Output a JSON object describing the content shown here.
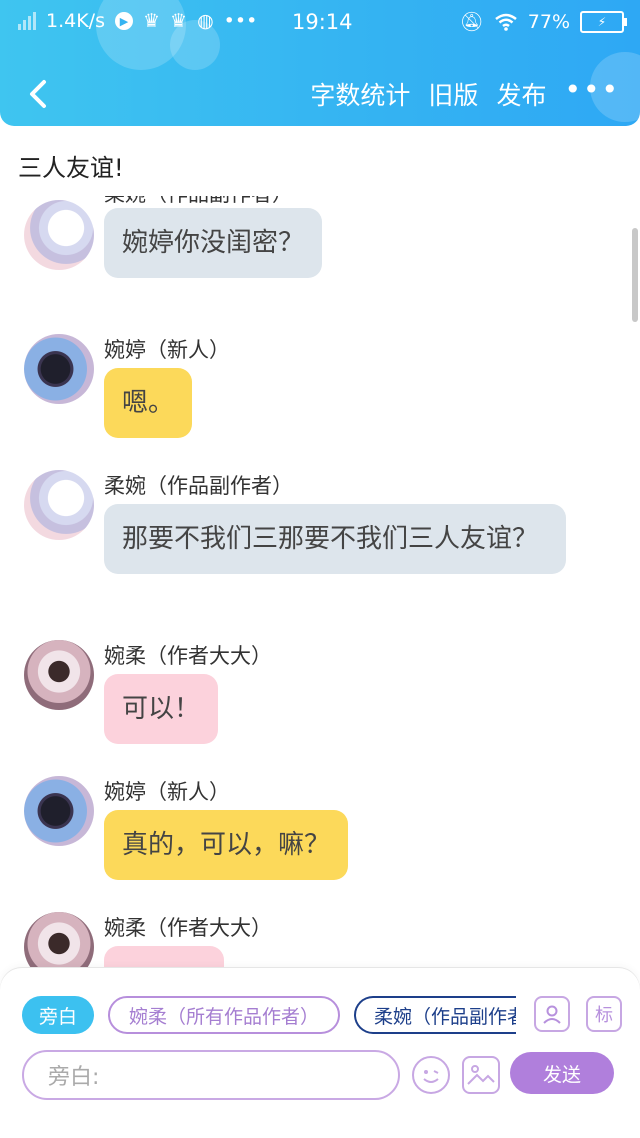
{
  "status_bar": {
    "speed": "1.4K/s",
    "time": "19:14",
    "battery_percent": "77%",
    "icons": [
      "signal-icon",
      "play-icon",
      "crown-icon",
      "crown-icon",
      "wechat-icon",
      "more-dots-icon",
      "mute-icon",
      "wifi-icon",
      "battery-icon"
    ]
  },
  "navbar": {
    "word_count_label": "字数统计",
    "old_version_label": "旧版",
    "publish_label": "发布",
    "more_label": "•••"
  },
  "story_title": "三人友谊!",
  "messages": [
    {
      "sender": "柔婉（作品副作者）",
      "text": "婉婷你没闺密？",
      "style": "gray",
      "avatar": "avatar-rouwan"
    },
    {
      "sender": "婉婷（新人）",
      "text": "嗯。",
      "style": "yellow",
      "avatar": "avatar-wanting"
    },
    {
      "sender": "柔婉（作品副作者）",
      "text": "那要不我们三那要不我们三人友谊？",
      "style": "gray",
      "avatar": "avatar-rouwan"
    },
    {
      "sender": "婉柔（作者大大）",
      "text": "可以！",
      "style": "pink",
      "avatar": "avatar-wanrou"
    },
    {
      "sender": "婉婷（新人）",
      "text": "真的，可以，嘛？",
      "style": "yellow",
      "avatar": "avatar-wanting"
    },
    {
      "sender": "婉柔（作者大大）",
      "text": "",
      "style": "pink",
      "avatar": "avatar-wanrou"
    }
  ],
  "composer": {
    "roles": [
      "旁白",
      "婉柔（所有作品作者）",
      "柔婉（作品副作者"
    ],
    "selected_role": "旁白",
    "role_tool_label": "",
    "tag_tool_label": "标",
    "input_placeholder": "旁白:",
    "send_label": "发送"
  },
  "colors": {
    "header": "#35b4f2",
    "bubble_gray": "#dde5ec",
    "bubble_yellow": "#fcd95a",
    "bubble_pink": "#fcd2dc",
    "accent_purple": "#b07fdc"
  }
}
